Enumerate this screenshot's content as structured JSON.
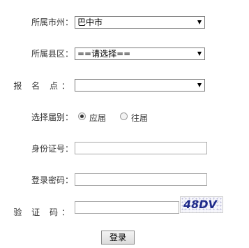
{
  "form": {
    "prefecture": {
      "label": "所属市州：",
      "value": "巴中市"
    },
    "county": {
      "label": "所属县区：",
      "value": "==请选择=="
    },
    "site": {
      "label": "报 名 点：",
      "value": ""
    },
    "grade": {
      "label": "选择届别：",
      "options": [
        {
          "label": "应届",
          "checked": true
        },
        {
          "label": "往届",
          "checked": false
        }
      ]
    },
    "id_number": {
      "label": "身份证号：",
      "value": ""
    },
    "password": {
      "label": "登录密码：",
      "value": ""
    },
    "captcha": {
      "label": "验 证 码：",
      "value": "",
      "image_text": "48DV"
    },
    "login_button": "登录"
  }
}
